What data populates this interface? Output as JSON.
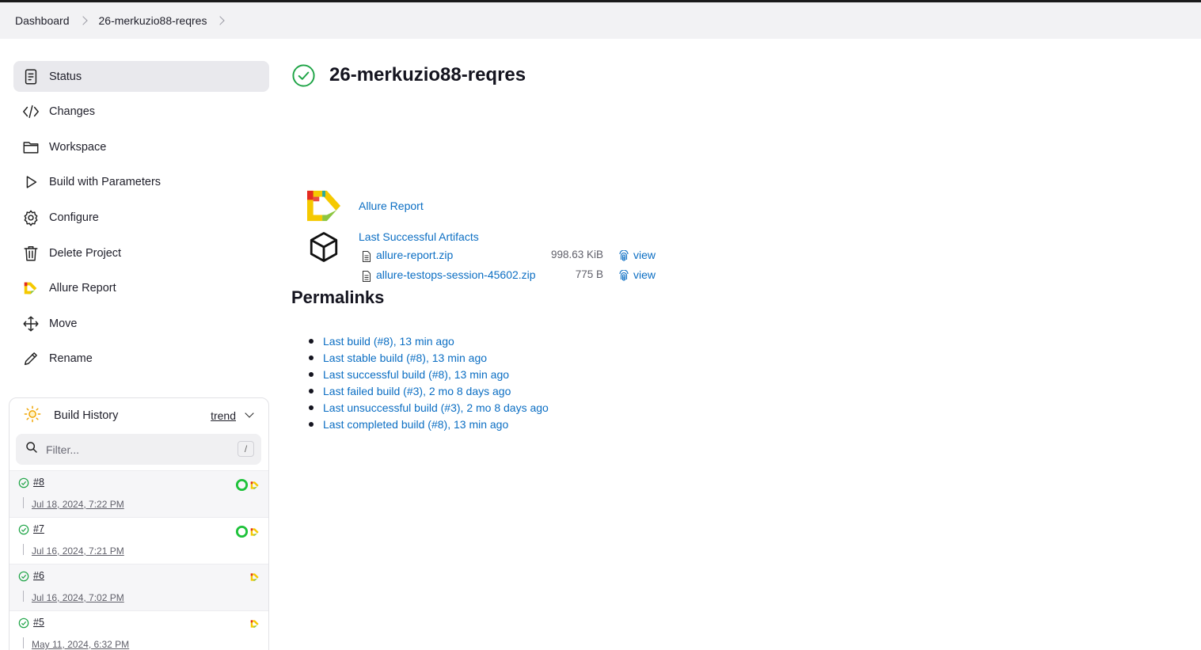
{
  "breadcrumb": {
    "items": [
      "Dashboard",
      "26-merkuzio88-reqres"
    ]
  },
  "sidebar": {
    "items": [
      {
        "label": "Status",
        "icon": "status-icon"
      },
      {
        "label": "Changes",
        "icon": "code-icon"
      },
      {
        "label": "Workspace",
        "icon": "folder-icon"
      },
      {
        "label": "Build with Parameters",
        "icon": "play-icon"
      },
      {
        "label": "Configure",
        "icon": "gear-icon"
      },
      {
        "label": "Delete Project",
        "icon": "trash-icon"
      },
      {
        "label": "Allure Report",
        "icon": "allure-icon"
      },
      {
        "label": "Move",
        "icon": "move-icon"
      },
      {
        "label": "Rename",
        "icon": "pencil-icon"
      }
    ]
  },
  "build_history": {
    "title": "Build History",
    "trend_label": "trend",
    "filter_placeholder": "Filter...",
    "filter_shortcut": "/",
    "builds": [
      {
        "number": "#8",
        "date": "Jul 18, 2024, 7:22 PM",
        "status": "success",
        "badges": [
          "testops",
          "allure"
        ]
      },
      {
        "number": "#7",
        "date": "Jul 16, 2024, 7:21 PM",
        "status": "success",
        "badges": [
          "testops",
          "allure"
        ]
      },
      {
        "number": "#6",
        "date": "Jul 16, 2024, 7:02 PM",
        "status": "success",
        "badges": [
          "allure"
        ]
      },
      {
        "number": "#5",
        "date": "May 11, 2024, 6:32 PM",
        "status": "success",
        "badges": [
          "allure"
        ]
      }
    ]
  },
  "main": {
    "title": "26-merkuzio88-reqres",
    "allure_link": "Allure Report",
    "artifacts_title": "Last Successful Artifacts",
    "artifacts": [
      {
        "name": "allure-report.zip",
        "size": "998.63 KiB",
        "view": "view"
      },
      {
        "name": "allure-testops-session-45602.zip",
        "size": "775 B",
        "view": "view"
      }
    ],
    "permalinks_title": "Permalinks",
    "permalinks": [
      "Last build (#8), 13 min ago",
      "Last stable build (#8), 13 min ago",
      "Last successful build (#8), 13 min ago",
      "Last failed build (#3), 2 mo 8 days ago",
      "Last unsuccessful build (#3), 2 mo 8 days ago",
      "Last completed build (#8), 13 min ago"
    ]
  },
  "colors": {
    "link": "#0b6ec3",
    "success": "#1ea446",
    "sidebar_active": "#e9e9ed"
  }
}
